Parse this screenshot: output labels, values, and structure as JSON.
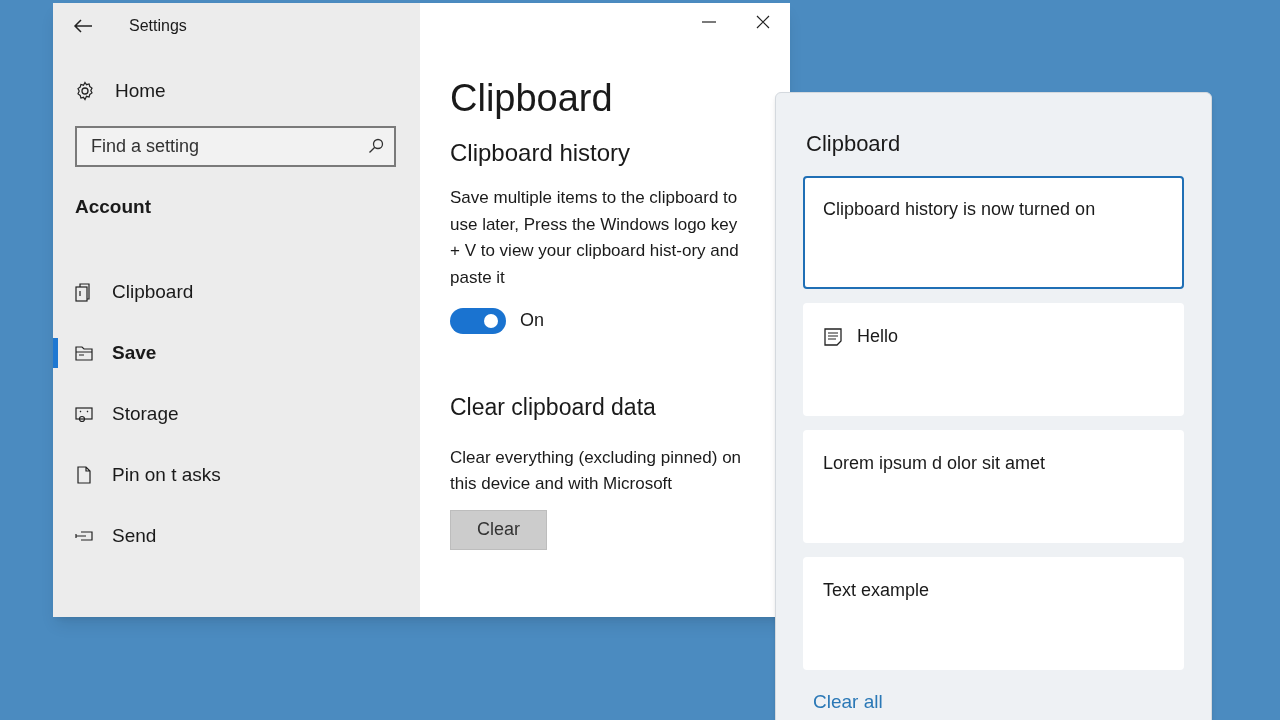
{
  "settings_window": {
    "title": "Settings",
    "sidebar": {
      "home": "Home",
      "search": {
        "placeholder": "Find a setting"
      },
      "section": "Account",
      "items": [
        {
          "label": "Clipboard",
          "selected": false
        },
        {
          "label": "Save",
          "selected": true
        },
        {
          "label": "Storage",
          "selected": false
        },
        {
          "label": "Pin on t asks",
          "selected": false
        },
        {
          "label": "Send",
          "selected": false
        }
      ]
    },
    "content": {
      "title": "Clipboard",
      "history": {
        "heading": "Clipboard history",
        "description": "Save multiple items to the clipboard to use later, Press the Windows logo key + V to view your clipboard hist-ory and paste it",
        "toggle": {
          "on": true,
          "label": "On"
        }
      },
      "clear": {
        "heading": "Clear clipboard data",
        "description": "Clear everything (excluding pinned) on this device and with Microsoft",
        "button": "Clear"
      }
    }
  },
  "clipboard_panel": {
    "title": "Clipboard",
    "items": [
      {
        "kind": "text",
        "text": "Clipboard history is now turned on",
        "selected": true
      },
      {
        "kind": "note",
        "text": "Hello",
        "selected": false
      },
      {
        "kind": "text",
        "text": "Lorem ipsum d olor sit amet",
        "selected": false
      },
      {
        "kind": "text",
        "text": "Text example",
        "selected": false
      }
    ],
    "clear_all": "Clear all"
  }
}
